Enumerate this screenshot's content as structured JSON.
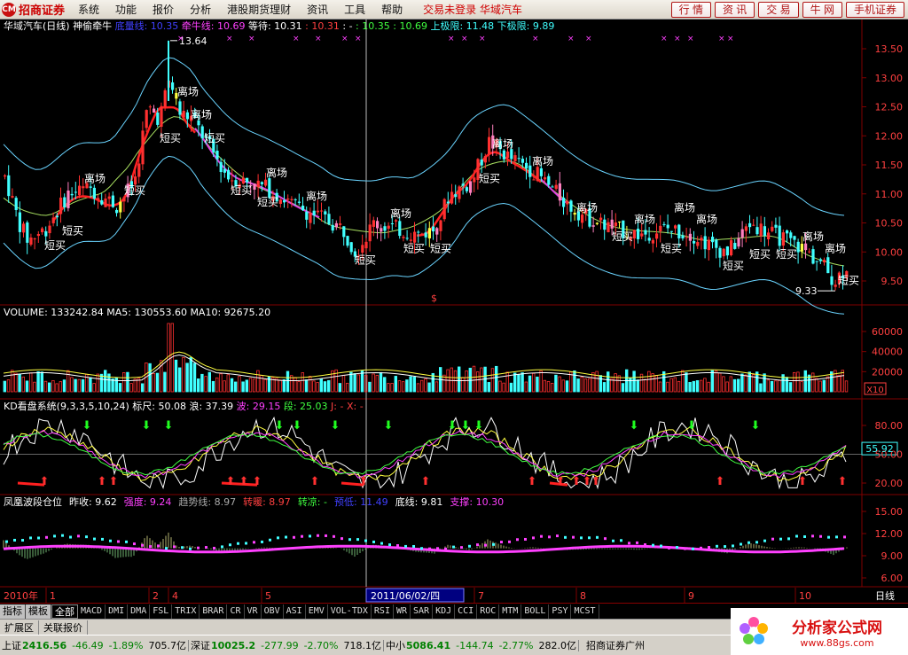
{
  "app": {
    "logo_text": "招商证券",
    "menu": [
      "系统",
      "功能",
      "报价",
      "分析",
      "港股期货理财",
      "资讯",
      "工具",
      "帮助"
    ],
    "status_text": "交易未登录  华域汽车",
    "buttons": [
      "行 情",
      "资 讯",
      "交 易",
      "牛 网",
      "手机证券"
    ]
  },
  "main_panel": {
    "title": "华域汽车(日线) 神偷牵牛",
    "indicators": [
      {
        "label": "底量线: 10.35",
        "color": "#4040ff"
      },
      {
        "label": "牵牛线: 10.69",
        "color": "#ff40ff"
      },
      {
        "label": "等待: 10.31",
        "color": "#ffffff"
      },
      {
        "label": ": 10.31",
        "color": "#ff4040"
      },
      {
        "label": ": -",
        "color": "#ffffff"
      },
      {
        "label": ": 10.35",
        "color": "#40ff40"
      },
      {
        "label": ": 10.69",
        "color": "#40ff40"
      },
      {
        "label": "上极限: 11.48",
        "color": "#40ffff"
      },
      {
        "label": "下极限: 9.89",
        "color": "#40ffff"
      }
    ],
    "y_axis": [
      "13.50",
      "13.00",
      "12.50",
      "12.00",
      "11.50",
      "11.00",
      "10.50",
      "10.00",
      "9.50"
    ],
    "high_label": "13.64",
    "low_label": "9.33",
    "label_short_buy": "短买",
    "label_exit": "离场"
  },
  "volume_panel": {
    "title": "VOLUME: 133242.84  MA5: 130553.60  MA10: 92675.20",
    "y_axis": [
      "60000",
      "40000",
      "20000"
    ],
    "unit": "X10"
  },
  "kd_panel": {
    "title": "KD看盘系统(9,3,3,5,10,24)",
    "values": [
      {
        "label": "标尺: 50.08",
        "color": "#ffffff"
      },
      {
        "label": "浪: 37.39",
        "color": "#ffffff"
      },
      {
        "label": "波: 29.15",
        "color": "#ff40ff"
      },
      {
        "label": "段: 25.03",
        "color": "#40ff40"
      },
      {
        "label": "J: -",
        "color": "#ff4040"
      },
      {
        "label": "X: -",
        "color": "#ff4040"
      }
    ],
    "y_axis": [
      "80.00",
      "50.00",
      "20.00"
    ],
    "current": "55.92"
  },
  "phoenix_panel": {
    "title": "凤凰波段仓位",
    "values": [
      {
        "label": "昨收: 9.62",
        "color": "#ffffff"
      },
      {
        "label": "强度: 9.24",
        "color": "#ff40ff"
      },
      {
        "label": "趋势线: 8.97",
        "color": "#aaaaaa"
      },
      {
        "label": "转暖: 8.97",
        "color": "#ff4040"
      },
      {
        "label": "转凉: -",
        "color": "#40ff40"
      },
      {
        "label": "预低: 11.49",
        "color": "#4040ff"
      },
      {
        "label": "底线: 9.81",
        "color": "#ffffff"
      },
      {
        "label": "支撑: 10.30",
        "color": "#ff40ff"
      }
    ],
    "y_axis": [
      "15.00",
      "12.00",
      "9.00",
      "6.00"
    ]
  },
  "x_axis": {
    "year_label": "2010年",
    "months": [
      "1",
      "2",
      "4",
      "5",
      "6",
      "7",
      "8",
      "9",
      "10"
    ],
    "cursor_date": "2011/06/02/四",
    "period": "日线"
  },
  "tabs": {
    "special": [
      "指标",
      "模板"
    ],
    "active": "全部",
    "items": [
      "MACD",
      "DMI",
      "DMA",
      "FSL",
      "TRIX",
      "BRAR",
      "CR",
      "VR",
      "OBV",
      "ASI",
      "EMV",
      "VOL-TDX",
      "RSI",
      "WR",
      "SAR",
      "KDJ",
      "CCI",
      "ROC",
      "MTM",
      "BOLL",
      "PSY",
      "MCST"
    ]
  },
  "ext_tabs": [
    "扩展区",
    "关联报价"
  ],
  "ticker": [
    {
      "name": "上证",
      "value": "2416.56",
      "change": "-46.49",
      "pct": "-1.89%",
      "amount": "705.7亿"
    },
    {
      "name": "深证",
      "value": "10025.2",
      "change": "-277.99",
      "pct": "-2.70%",
      "amount": "718.1亿"
    },
    {
      "name": "中小",
      "value": "5086.41",
      "change": "-144.74",
      "pct": "-2.77%",
      "amount": "282.0亿"
    }
  ],
  "broker": "招商证券广州",
  "brand": {
    "name": "分析家公式网",
    "url": "www.88gs.com"
  },
  "colors": {
    "up": "#ff3030",
    "down": "#40ffff",
    "pink": "#ff80c0",
    "yellow": "#ffff40",
    "grid": "#800000"
  }
}
